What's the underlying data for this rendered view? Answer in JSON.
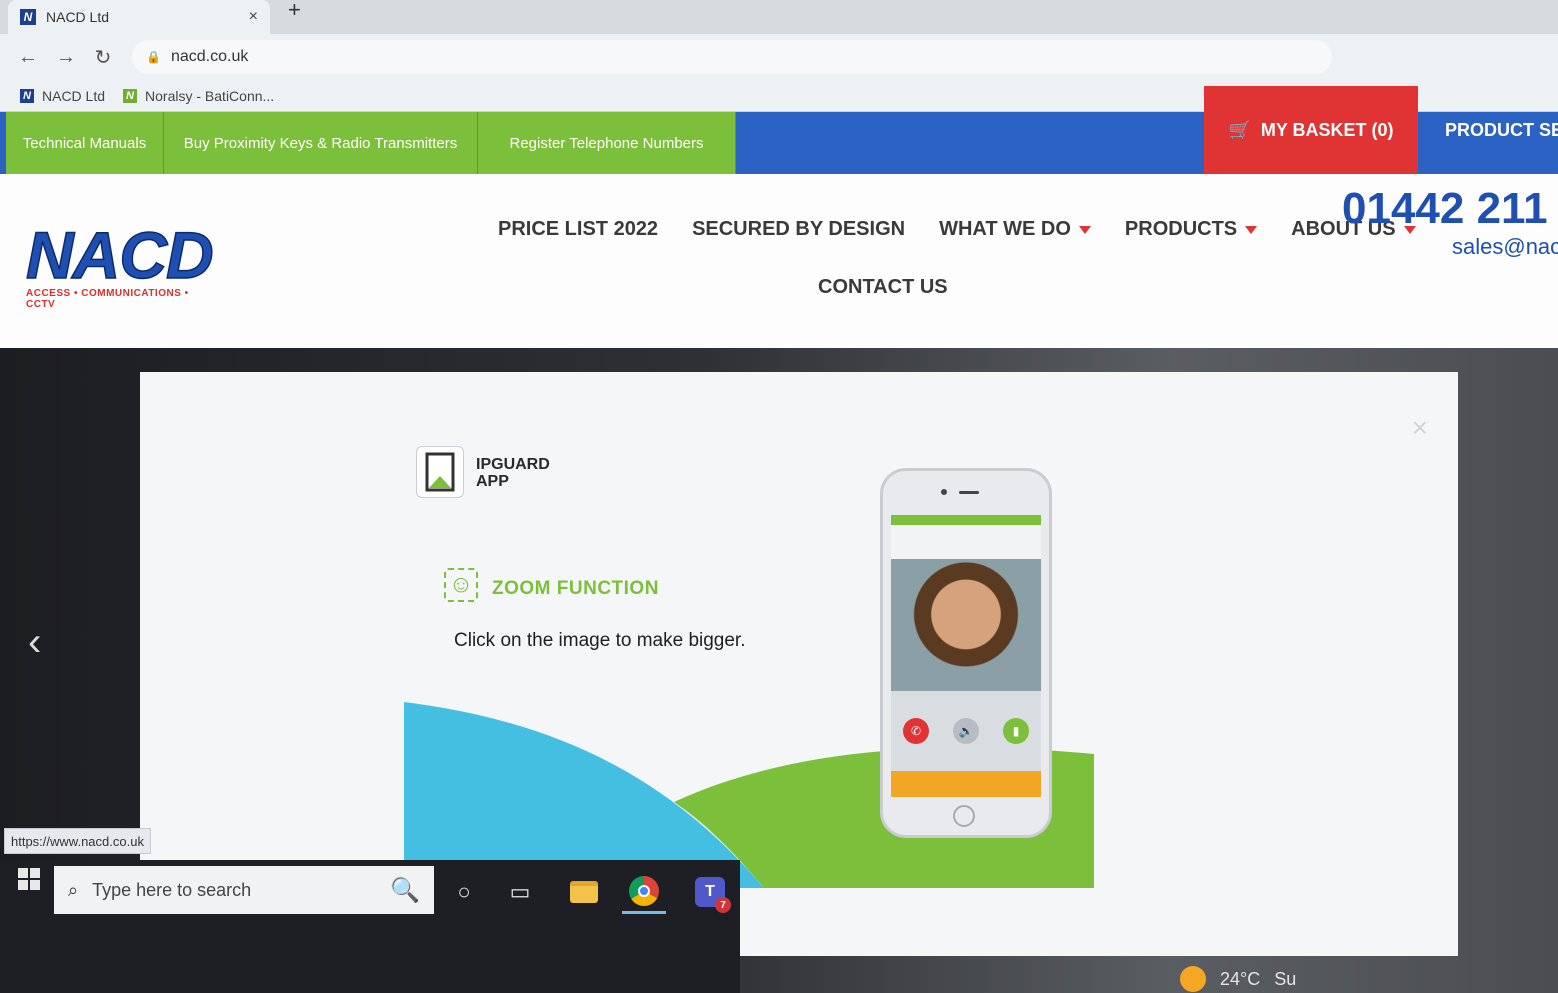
{
  "browser": {
    "tab_title": "NACD Ltd",
    "tab_close": "×",
    "new_tab": "+",
    "url": "nacd.co.uk",
    "bookmarks": [
      {
        "label": "NACD Ltd",
        "favicon": "N"
      },
      {
        "label": "Noralsy - BatiConn...",
        "favicon": "N"
      }
    ],
    "status_url": "https://www.nacd.co.uk"
  },
  "site": {
    "top_links": [
      "Technical Manuals",
      "Buy Proximity Keys & Radio Transmitters",
      "Register Telephone Numbers"
    ],
    "basket_label": "MY BASKET (0)",
    "product_search_label": "PRODUCT SE",
    "logo": {
      "wordmark": "NACD",
      "tagline": "ACCESS • COMMUNICATIONS • CCTV"
    },
    "menu": {
      "price_list": "PRICE LIST 2022",
      "secured": "SECURED BY DESIGN",
      "what_we_do": "WHAT WE DO",
      "products": "PRODUCTS",
      "about_us": "ABOUT US",
      "contact_us": "CONTACT US"
    },
    "phone": "01442 211",
    "email": "sales@nac",
    "colors": {
      "blue": "#2d62c5",
      "green": "#7cbf3a",
      "red": "#e03434"
    }
  },
  "modal": {
    "close": "×",
    "app_title_line1": "IPGUARD",
    "app_title_line2": "APP",
    "zoom_title": "ZOOM FUNCTION",
    "zoom_desc": "Click on the image to make bigger."
  },
  "taskbar": {
    "search_placeholder": "Type here to search",
    "teams_badge": "7",
    "weather_temp": "24°C",
    "weather_text": "Su"
  }
}
